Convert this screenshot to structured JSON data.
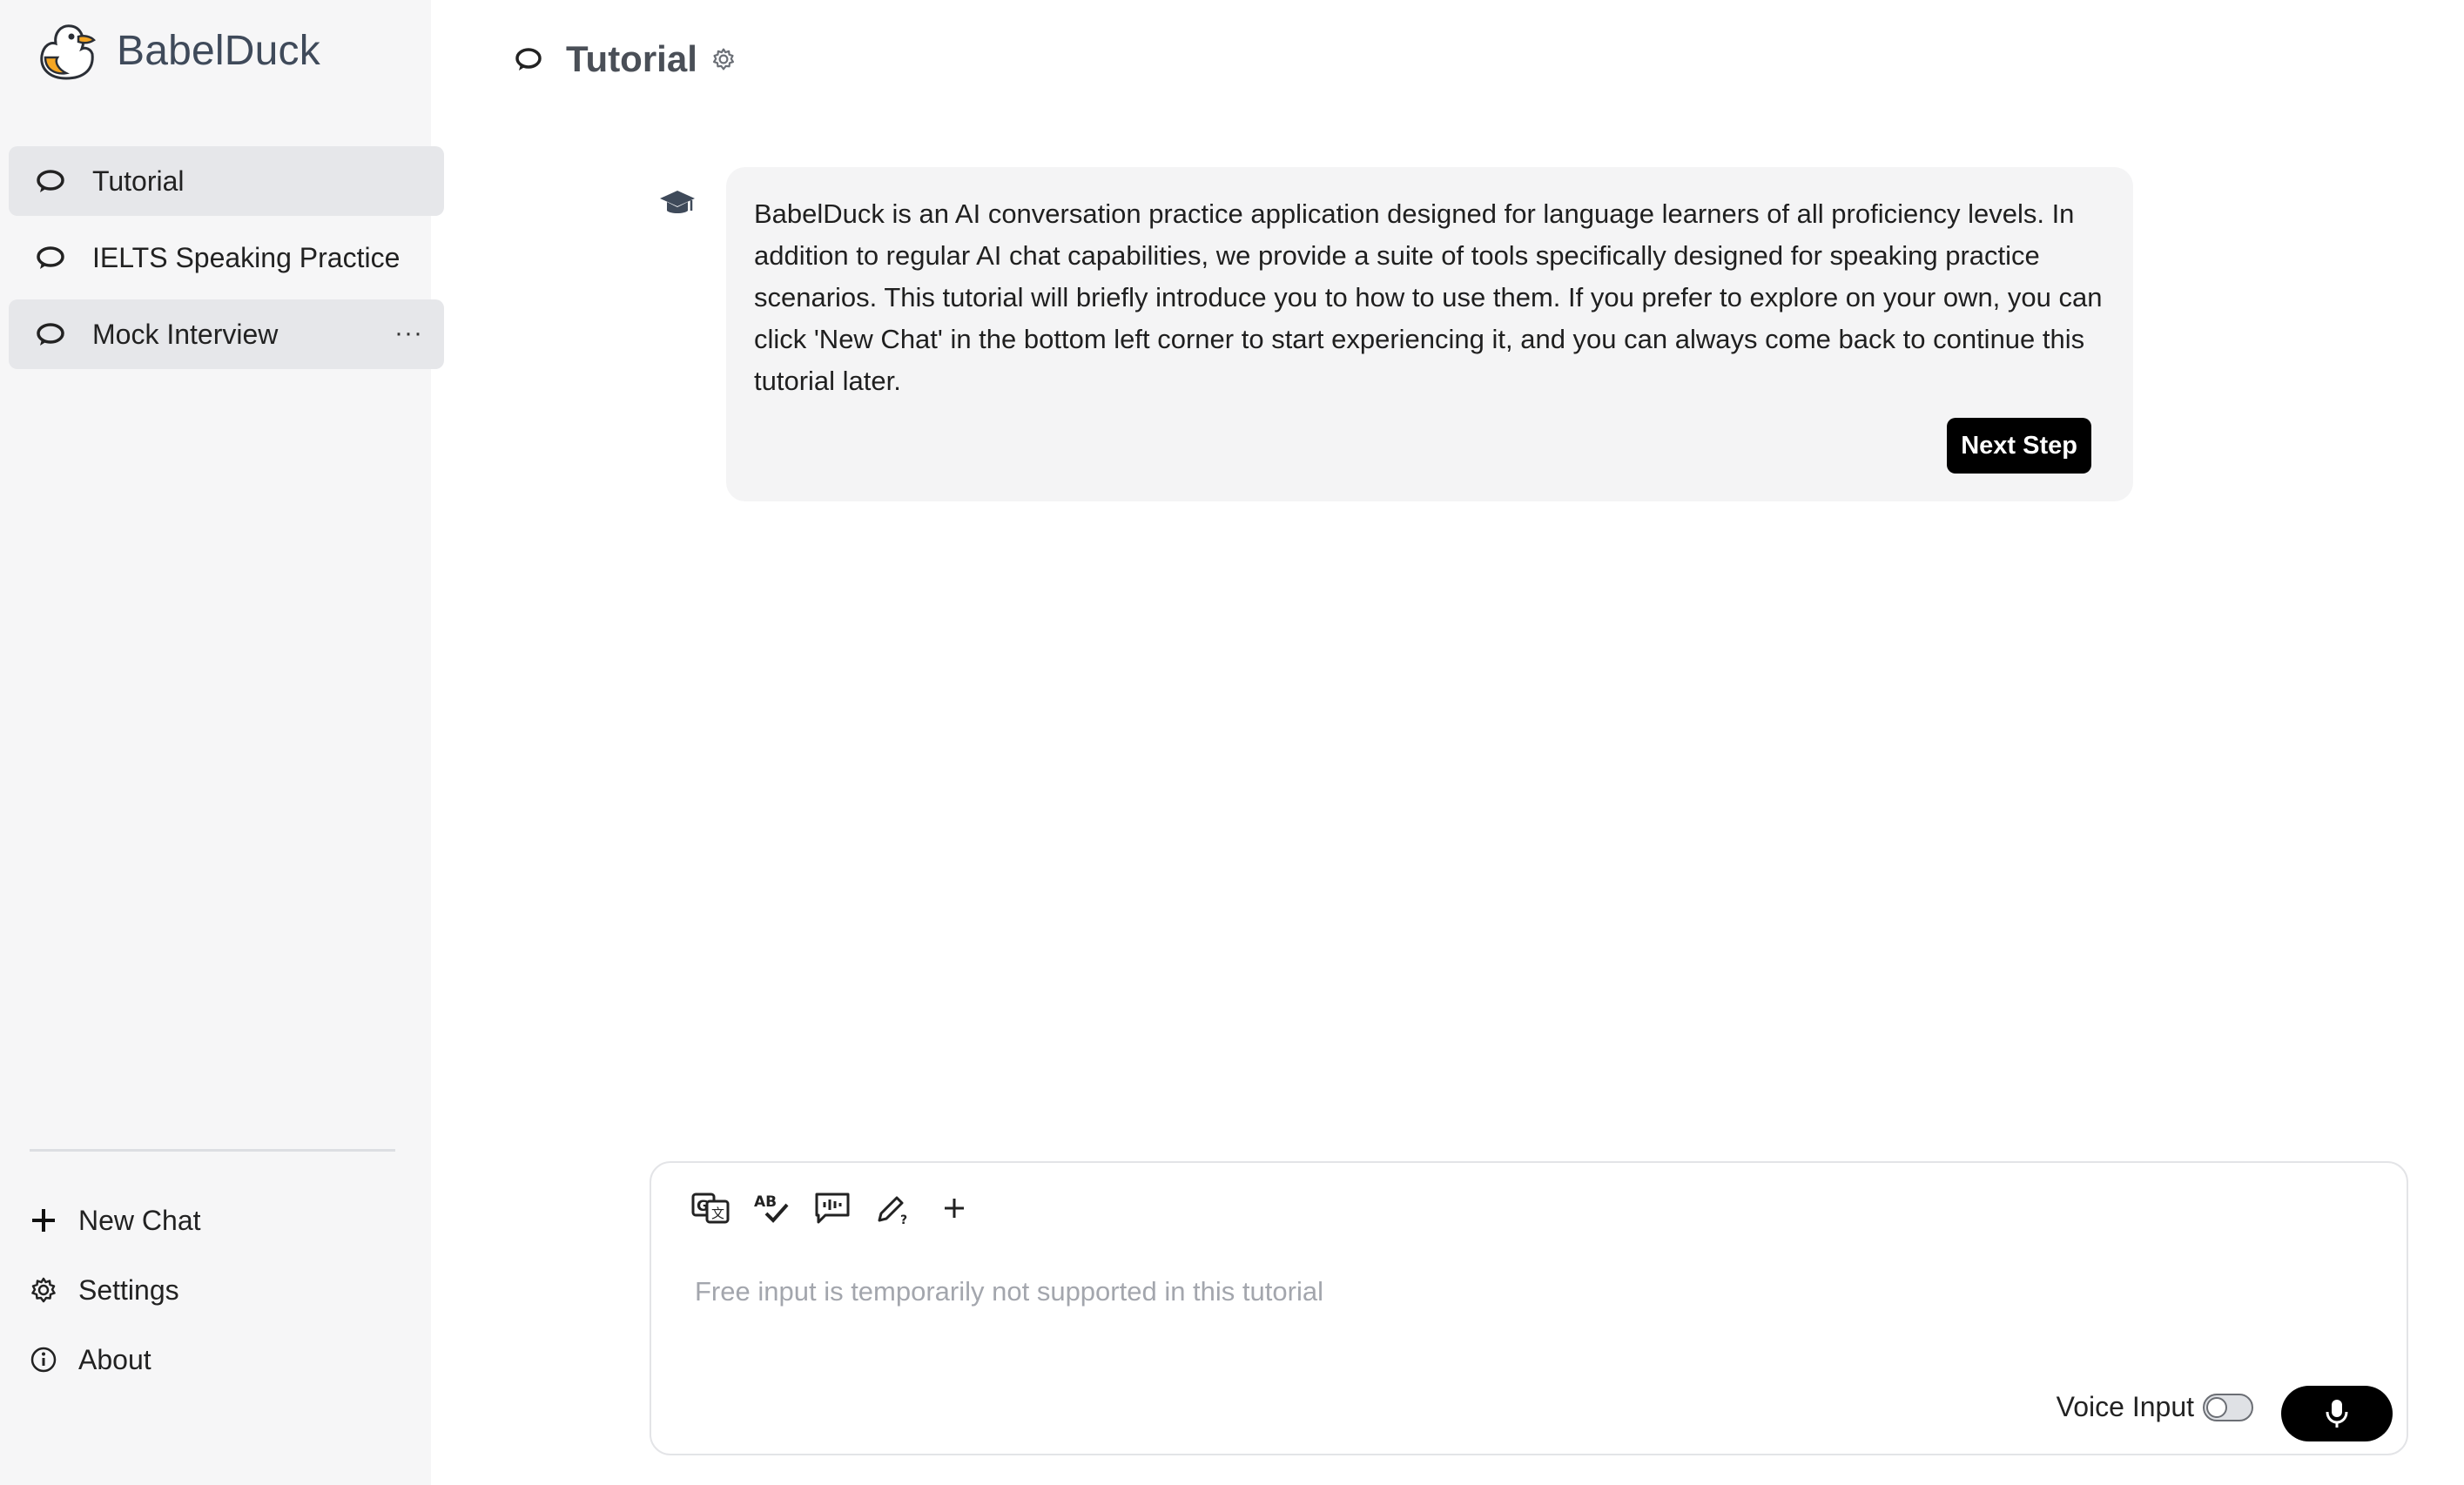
{
  "app": {
    "name": "BabelDuck"
  },
  "sidebar": {
    "chats": [
      {
        "label": "Tutorial",
        "active": true
      },
      {
        "label": "IELTS Speaking Practice",
        "active": false
      },
      {
        "label": "Mock Interview",
        "active": false,
        "more": "···"
      }
    ],
    "bottom": [
      {
        "label": "New Chat",
        "icon": "plus-icon"
      },
      {
        "label": "Settings",
        "icon": "gear-icon"
      },
      {
        "label": "About",
        "icon": "info-icon"
      }
    ]
  },
  "header": {
    "title": "Tutorial"
  },
  "message": {
    "text": "BabelDuck is an AI conversation practice application designed for language learners of all proficiency levels. In addition to regular AI chat capabilities, we provide a suite of tools specifically designed for speaking practice scenarios. This tutorial will briefly introduce you to how to use them. If you prefer to explore on your own, you can click 'New Chat' in the bottom left corner to start experiencing it, and you can always come back to continue this tutorial later.",
    "button": "Next Step"
  },
  "composer": {
    "placeholder": "Free input is temporarily not supported in this tutorial",
    "voice_label": "Voice Input",
    "voice_enabled": false,
    "tools": [
      "translate-icon",
      "grammar-check-icon",
      "voice-feedback-icon",
      "rewrite-icon",
      "add-tool-icon"
    ]
  },
  "colors": {
    "accent": "#000000",
    "sidebar_bg": "#f6f6f7",
    "bubble_bg": "#f4f4f5",
    "placeholder": "#a3a6ad"
  }
}
